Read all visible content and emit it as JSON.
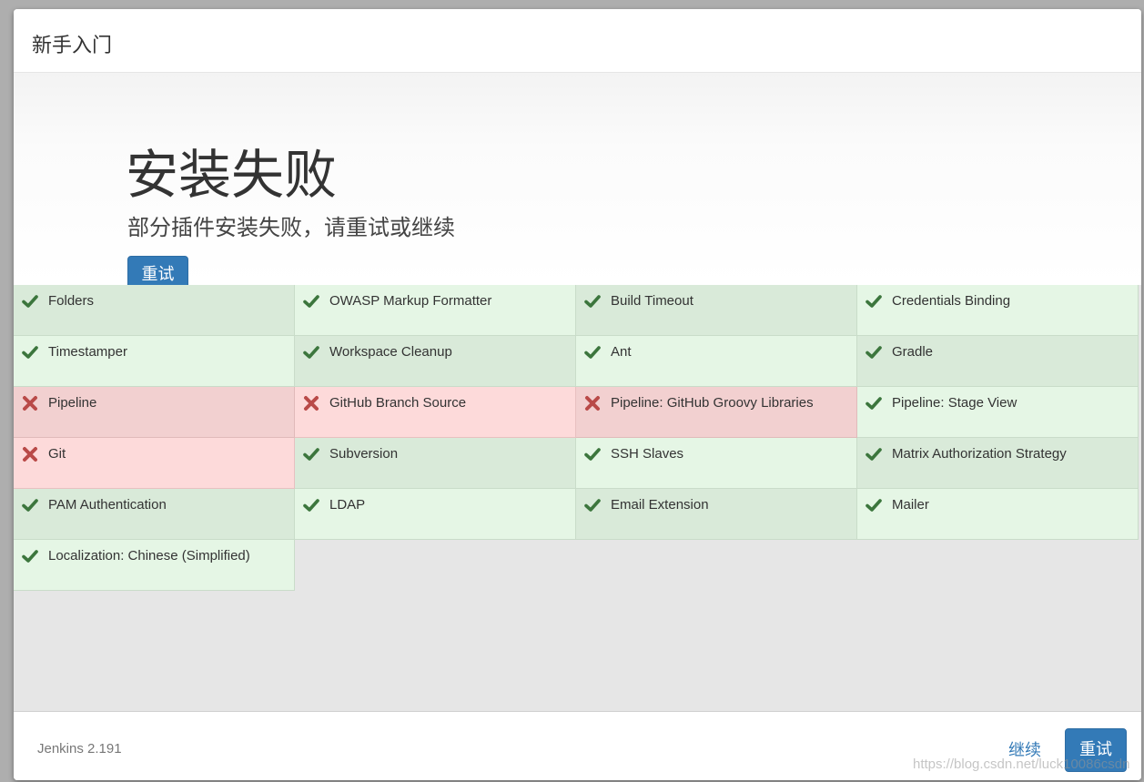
{
  "dialog": {
    "title": "新手入门"
  },
  "hero": {
    "title": "安装失败",
    "subtitle": "部分插件安装失败，请重试或继续",
    "retry_label": "重试"
  },
  "plugins": [
    {
      "name": "Folders",
      "status": "success"
    },
    {
      "name": "OWASP Markup Formatter",
      "status": "success"
    },
    {
      "name": "Build Timeout",
      "status": "success"
    },
    {
      "name": "Credentials Binding",
      "status": "success"
    },
    {
      "name": "Timestamper",
      "status": "success"
    },
    {
      "name": "Workspace Cleanup",
      "status": "success"
    },
    {
      "name": "Ant",
      "status": "success"
    },
    {
      "name": "Gradle",
      "status": "success"
    },
    {
      "name": "Pipeline",
      "status": "failed"
    },
    {
      "name": "GitHub Branch Source",
      "status": "failed"
    },
    {
      "name": "Pipeline: GitHub Groovy Libraries",
      "status": "failed"
    },
    {
      "name": "Pipeline: Stage View",
      "status": "success"
    },
    {
      "name": "Git",
      "status": "failed"
    },
    {
      "name": "Subversion",
      "status": "success"
    },
    {
      "name": "SSH Slaves",
      "status": "success"
    },
    {
      "name": "Matrix Authorization Strategy",
      "status": "success"
    },
    {
      "name": "PAM Authentication",
      "status": "success"
    },
    {
      "name": "LDAP",
      "status": "success"
    },
    {
      "name": "Email Extension",
      "status": "success"
    },
    {
      "name": "Mailer",
      "status": "success"
    },
    {
      "name": "Localization: Chinese (Simplified)",
      "status": "success"
    }
  ],
  "icons": {
    "success": "check-icon",
    "failed": "cross-icon"
  },
  "colors": {
    "success_icon": "#3c763d",
    "failed_icon": "#b94a48",
    "primary": "#337ab7"
  },
  "footer": {
    "version": "Jenkins 2.191",
    "continue_label": "继续",
    "retry_label": "重试",
    "watermark": "https://blog.csdn.net/luck10086csdn"
  }
}
